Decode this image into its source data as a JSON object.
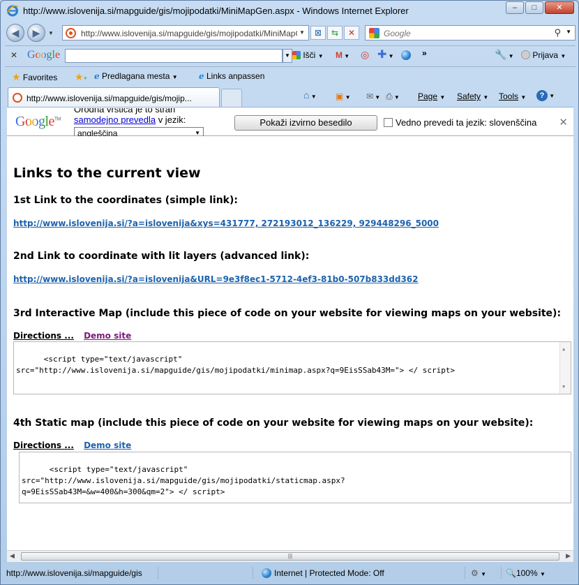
{
  "window": {
    "title": "http://www.islovenija.si/mapguide/gis/mojipodatki/MiniMapGen.aspx - Windows Internet Explorer",
    "minimize": "–",
    "maximize": "□",
    "close": "✕"
  },
  "address": {
    "url": "http://www.islovenija.si/mapguide/gis/mojipodatki/MiniMapGen.aspx",
    "search_placeholder": "Google"
  },
  "google_toolbar": {
    "logo": "Google",
    "search_label": "Išči",
    "more": "»",
    "signin": "Prijava"
  },
  "favorites": {
    "favorites_label": "Favorites",
    "suggested_sites": "Predlagana mesta",
    "customize_links": "Links anpassen"
  },
  "tab": {
    "label": "http://www.islovenija.si/mapguide/gis/mojip..."
  },
  "command_bar": {
    "page": "Page",
    "safety": "Safety",
    "tools": "Tools"
  },
  "translate_bar": {
    "logo": "Google",
    "text_line1": "Orodna vrstica je to stran",
    "link_text": "samodejno prevedla",
    "text_after_link": " v jezik:",
    "language": "angleščina",
    "show_original": "Pokaži izvirno besedilo",
    "always_translate": "Vedno prevedi ta jezik: slovenščina"
  },
  "content": {
    "heading": "Links to the current view",
    "s1_title": "1st Link to the coordinates (simple link):",
    "s1_link": "http://www.islovenija.si/?a=islovenija&xys=431777, 272193012_136229, 929448296_5000",
    "s2_title": "2nd Link to coordinate with lit layers (advanced link):",
    "s2_link": "http://www.islovenija.si/?a=islovenija&URL=9e3f8ec1-5712-4ef3-81b0-507b833dd362",
    "s3_title": "3rd Interactive Map (include this piece of code on your website for viewing maps on your website):",
    "s3_directions": "Directions ...",
    "s3_demo": "Demo site",
    "s3_code": "<script type=\"text/javascript\"\nsrc=\"http://www.islovenija.si/mapguide/gis/mojipodatki/minimap.aspx?q=9EisSSab43M=\"> </ script>",
    "s4_title": "4th Static map (include this piece of code on your website for viewing maps on your website):",
    "s4_directions": "Directions ...",
    "s4_demo": "Demo site",
    "s4_code": "<script type=\"text/javascript\"\nsrc=\"http://www.islovenija.si/mapguide/gis/mojipodatki/staticmap.aspx?\nq=9EisSSab43M=&w=400&h=300&qm=2\"> </ script>"
  },
  "status": {
    "url": "http://www.islovenija.si/mapguide/gis",
    "zone": "Internet | Protected Mode: Off",
    "zoom": "100%"
  }
}
